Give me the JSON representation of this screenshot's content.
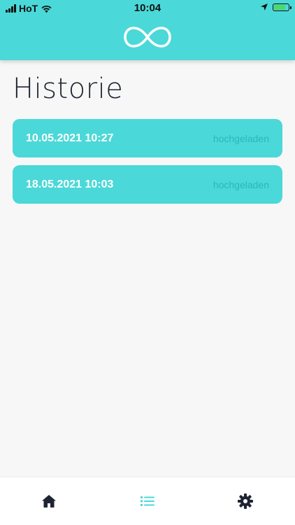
{
  "status_bar": {
    "carrier": "HoT",
    "time": "10:04",
    "battery_level": 0.85,
    "battery_color": "#4cd964"
  },
  "header": {
    "logo_icon": "infinity-icon",
    "background_color": "#4bd8d8"
  },
  "page": {
    "title": "Historie"
  },
  "history": {
    "items": [
      {
        "date": "10.05.2021 10:27",
        "status": "hochgeladen"
      },
      {
        "date": "18.05.2021 10:03",
        "status": "hochgeladen"
      }
    ]
  },
  "tab_bar": {
    "tabs": [
      {
        "icon": "home-icon",
        "active": false
      },
      {
        "icon": "list-icon",
        "active": true
      },
      {
        "icon": "gear-icon",
        "active": false
      }
    ],
    "active_color": "#4bd8d8",
    "inactive_color": "#1f2433"
  }
}
